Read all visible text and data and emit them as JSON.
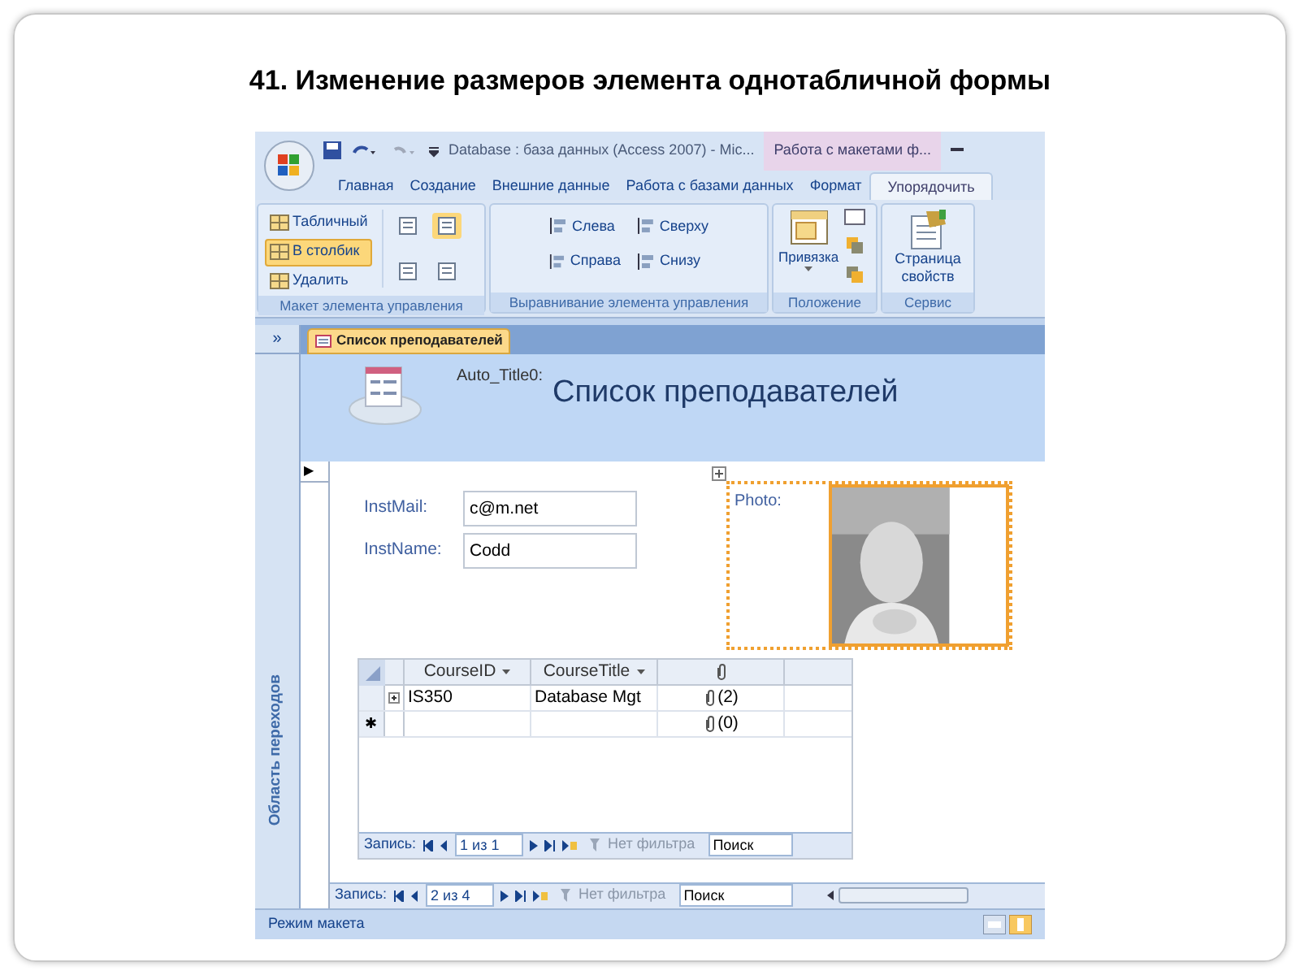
{
  "slide_title": "41. Изменение размеров элемента однотабличной формы",
  "window": {
    "title": "Database : база данных (Access 2007) - Mic...",
    "context_tab": "Работа с макетами ф..."
  },
  "ribbon_tabs": [
    {
      "label": "Главная",
      "selected": false
    },
    {
      "label": "Создание",
      "selected": false
    },
    {
      "label": "Внешние данные",
      "selected": false
    },
    {
      "label": "Работа с базами данных",
      "selected": false
    },
    {
      "label": "Формат",
      "selected": false
    },
    {
      "label": "Упорядочить",
      "selected": true
    }
  ],
  "ribbon_groups": [
    {
      "kind": "layout",
      "label": "Макет элемента управления",
      "items": [
        {
          "label": "Табличный",
          "selected": false
        },
        {
          "label": "В столбик",
          "selected": true
        },
        {
          "label": "Удалить",
          "selected": false
        }
      ],
      "tool_buttons": [
        {
          "selected": false
        },
        {
          "selected": true
        },
        {
          "selected": false
        },
        {
          "selected": false
        }
      ]
    },
    {
      "kind": "align",
      "label": "Выравнивание элемента управления",
      "items": [
        {
          "label": "Слева"
        },
        {
          "label": "Сверху"
        },
        {
          "label": "Справа"
        },
        {
          "label": "Снизу"
        }
      ]
    },
    {
      "kind": "position",
      "label": "Положение",
      "items": [
        {
          "label": "Привязка"
        }
      ]
    },
    {
      "kind": "tools",
      "label": "Сервис",
      "items": [
        {
          "label": "Страница свойств"
        }
      ]
    }
  ],
  "nav_pane": {
    "toggle": "»",
    "label": "Область переходов"
  },
  "document_tab": {
    "label": "Список преподавателей"
  },
  "form": {
    "title_label": "Auto_Title0:",
    "title": "Список преподавателей",
    "record_marker": "▶",
    "fields": [
      {
        "label": "InstMail:",
        "value": "c@m.net"
      },
      {
        "label": "InstName:",
        "value": "Codd"
      }
    ],
    "photo": {
      "label": "Photo:",
      "selected": true
    },
    "subform": {
      "columns": [
        {
          "kind": "text",
          "label": "CourseID"
        },
        {
          "kind": "text",
          "label": "CourseTitle"
        },
        {
          "kind": "attachment"
        }
      ],
      "rows": [
        {
          "kind": "record",
          "course_id": "IS350",
          "course_title": "Database Mgt",
          "attachments": "(2)"
        },
        {
          "kind": "new",
          "marker": "✱",
          "attachments": "(0)"
        }
      ],
      "nav": {
        "label": "Запись:",
        "position": "1 из 1",
        "filter": "Нет фильтра",
        "search": "Поиск"
      }
    }
  },
  "record_nav": {
    "label": "Запись:",
    "position": "2 из 4",
    "filter": "Нет фильтра",
    "search": "Поиск"
  },
  "status_bar": {
    "text": "Режим макета"
  }
}
